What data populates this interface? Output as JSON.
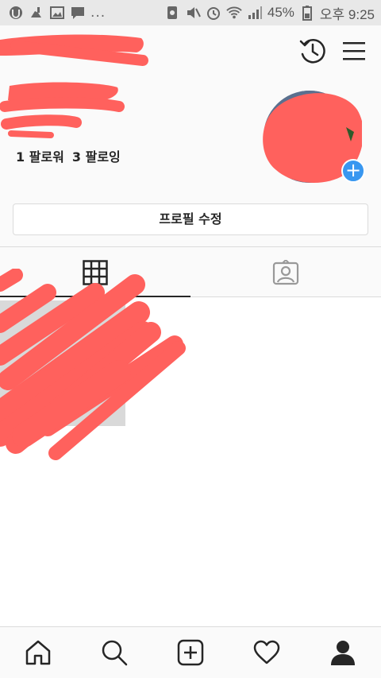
{
  "status_bar": {
    "battery": "45%",
    "time": "오후 9:25",
    "overflow": "..."
  },
  "header": {
    "username": ""
  },
  "profile": {
    "name": "",
    "followers_count": "1",
    "followers_label": "팔로워",
    "following_count": "3",
    "following_label": "팔로잉",
    "add_story_symbol": "+",
    "edit_button_label": "프로필 수정"
  },
  "tabs": [
    {
      "name": "grid",
      "icon": "grid-icon",
      "active": true
    },
    {
      "name": "tagged",
      "icon": "tagged-person-icon",
      "active": false
    }
  ],
  "bottom_nav": [
    {
      "icon": "home-icon"
    },
    {
      "icon": "search-icon"
    },
    {
      "icon": "add-post-icon"
    },
    {
      "icon": "heart-icon"
    },
    {
      "icon": "profile-icon"
    }
  ],
  "colors": {
    "redaction": "#ff615d",
    "accent": "#3897f0",
    "text": "#262626",
    "divider": "#dbdbdb"
  }
}
